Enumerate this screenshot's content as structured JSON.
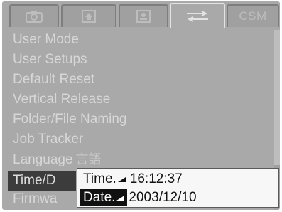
{
  "tabs": [
    {
      "icon": "camera-icon",
      "label": ""
    },
    {
      "icon": "playback-icon",
      "label": ""
    },
    {
      "icon": "image-settings-icon",
      "label": ""
    },
    {
      "icon": "setup-tools-icon",
      "label": "",
      "active": true
    },
    {
      "icon": "",
      "label": "CSM"
    }
  ],
  "menu": {
    "items": [
      {
        "label": "User Mode"
      },
      {
        "label": "User Setups"
      },
      {
        "label": "Default Reset"
      },
      {
        "label": "Vertical Release"
      },
      {
        "label": "Folder/File Naming"
      },
      {
        "label": "Job Tracker"
      },
      {
        "label": "Language",
        "glyph": "言語"
      },
      {
        "label": "Time/D",
        "selected": true
      },
      {
        "label": "Firmwa"
      }
    ]
  },
  "popup": {
    "time_label": "Time.",
    "time_value": "16:12:37",
    "date_label": "Date.",
    "date_value": "2003/12/10"
  },
  "colors": {
    "lcd_background": "#a9a9a9",
    "menu_text": "#d7d7d7",
    "selected_background": "#3c3c3c",
    "popup_background": "#f7f7f7"
  }
}
